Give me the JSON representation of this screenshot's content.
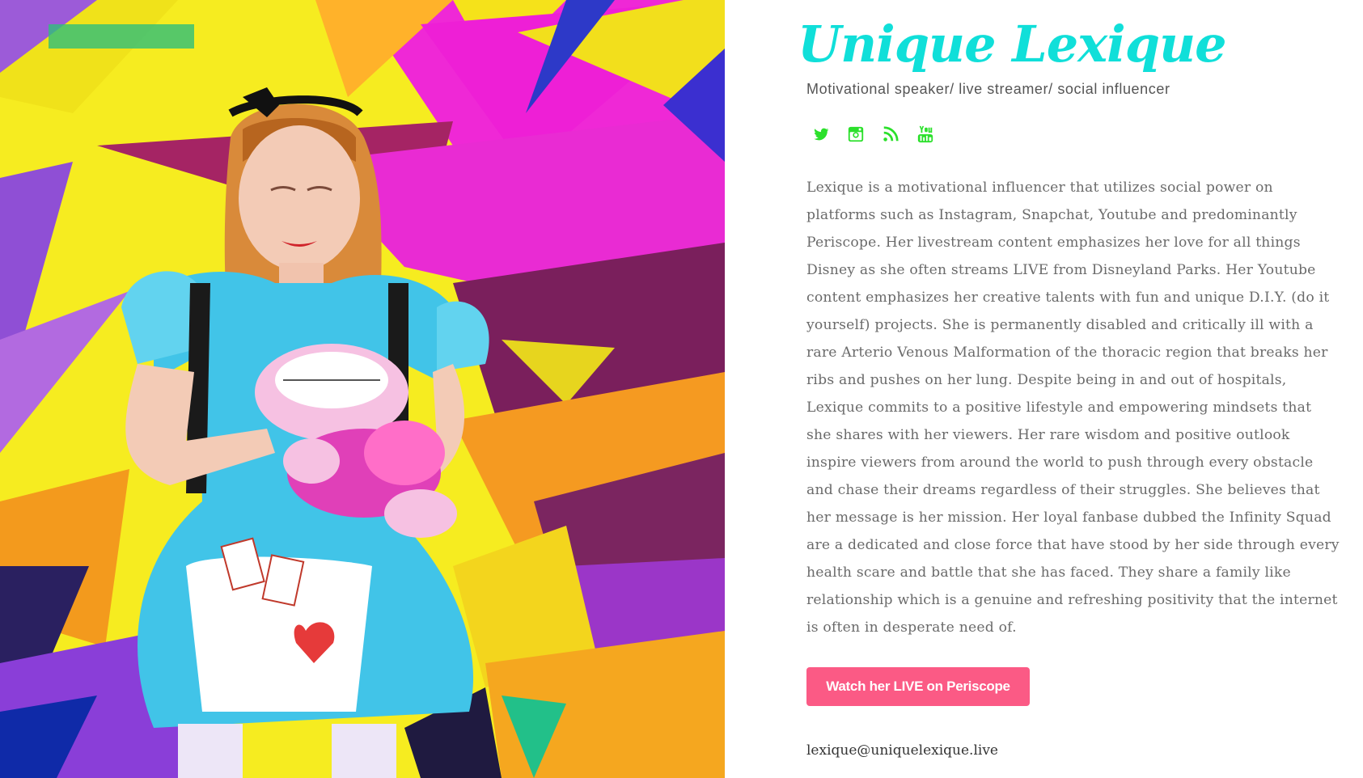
{
  "profile": {
    "title": "Unique Lexique",
    "subtitle": "Motivational speaker/ live streamer/ social influencer",
    "bio": "Lexique is a motivational influencer that utilizes social power on platforms such as Instagram, Snapchat, Youtube and predominantly Periscope. Her livestream content emphasizes her love for all things Disney as she often streams LIVE from Disneyland Parks. Her Youtube content emphasizes her creative talents with fun and unique D.I.Y. (do it yourself) projects. She is permanently disabled and critically ill with a rare Arterio Venous Malformation of the thoracic region that breaks her ribs and pushes on her lung. Despite being in and out of hospitals, Lexique commits to a positive lifestyle and empowering mindsets that she shares with her viewers. Her rare wisdom and positive outlook inspire viewers from around the world to push through every obstacle and chase their dreams regardless of their struggles. She believes that her message is her mission. Her loyal fanbase dubbed the Infinity Squad are a dedicated and close force that have stood by her side through every health scare and battle that she has faced. They share a family like relationship which is a genuine and refreshing positivity that the internet is often in desperate need of.",
    "cta_label": "Watch her LIVE on Periscope",
    "email": "lexique@uniquelexique.live"
  },
  "social": [
    {
      "icon": "twitter-icon"
    },
    {
      "icon": "instagram-icon"
    },
    {
      "icon": "rss-icon"
    },
    {
      "icon": "youtube-icon"
    }
  ],
  "colors": {
    "title": "#10dfd9",
    "social_icons": "#2be02b",
    "cta_background": "#fb5a85",
    "body_text": "#6a6a6a"
  }
}
